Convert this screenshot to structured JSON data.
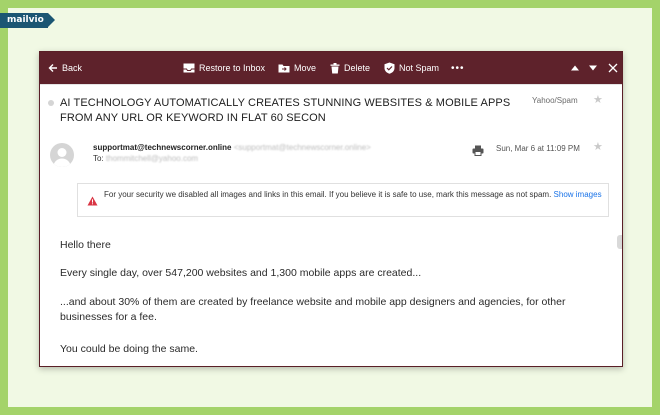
{
  "brand": "mailvio",
  "toolbar": {
    "back": "Back",
    "restore": "Restore to Inbox",
    "move": "Move",
    "delete": "Delete",
    "not_spam": "Not Spam",
    "more": "•••"
  },
  "email": {
    "subject": "AI TECHNOLOGY AUTOMATICALLY CREATES STUNNING WEBSITES & MOBILE APPS FROM ANY URL OR KEYWORD IN FLAT 60 SECON",
    "folder": "Yahoo/Spam",
    "from_name": "supportmat@technewscorner.online",
    "from_addr": "<supportmat@technewscorner.online>",
    "to_label": "To:",
    "to_addr": "thommitchell@yahoo.com",
    "date": "Sun, Mar 6 at 11:09 PM"
  },
  "notice": {
    "text": "For your security we disabled all images and links in this email. If you believe it is safe to use, mark this message as not spam.",
    "link": "Show images"
  },
  "body": {
    "p1": "Hello there",
    "p2": "Every single day, over 547,200 websites and 1,300 mobile apps are created...",
    "p3": "...and about 30% of them are created by freelance website and mobile app designers and agencies, for other businesses for a fee.",
    "p4": "You could be doing the same."
  },
  "colors": {
    "toolbar_bg": "#5e222b",
    "frame_bg": "#a4d36a",
    "link": "#1a73e8",
    "warning": "#d93544"
  }
}
